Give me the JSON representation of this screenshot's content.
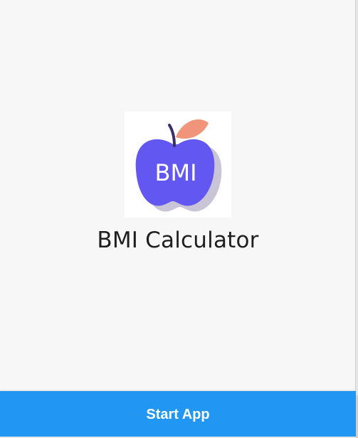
{
  "app": {
    "title": "BMI Calculator",
    "logo_text": "BMI"
  },
  "footer": {
    "start_label": "Start App"
  },
  "colors": {
    "apple": "#6257f0",
    "apple_shadow": "#c9c4d6",
    "leaf": "#f0957a",
    "stem": "#3b2f6b",
    "button": "#2196f3",
    "background": "#f7f7f7"
  },
  "icons": {
    "logo": "apple-icon"
  }
}
